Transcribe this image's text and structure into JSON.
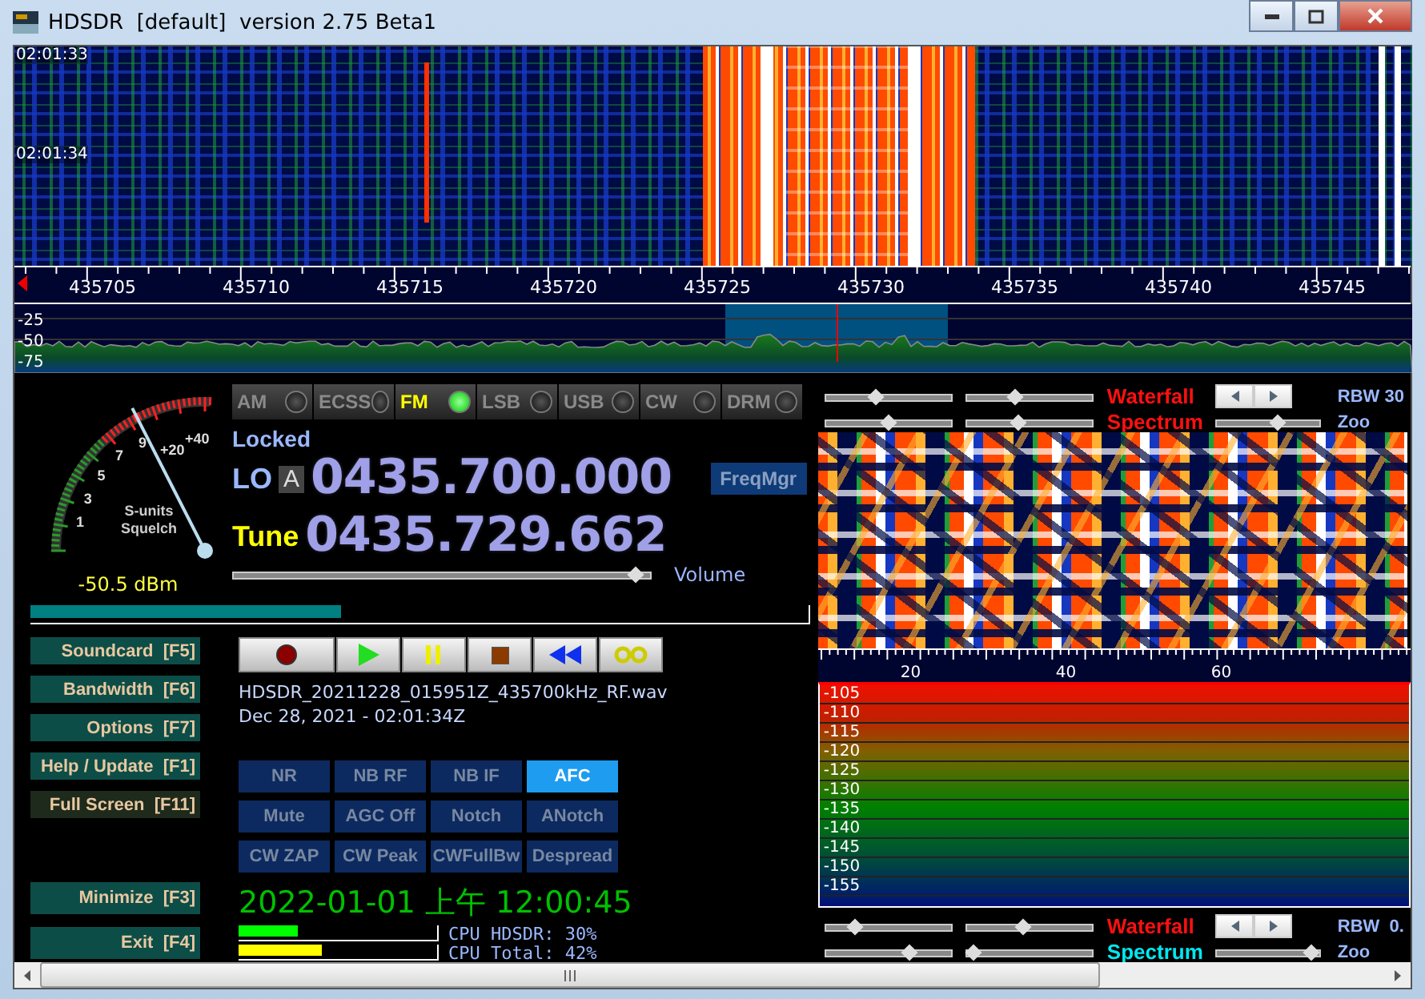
{
  "window": {
    "title": "HDSDR  [default]  version 2.75 Beta1"
  },
  "waterfall": {
    "timestamps": [
      "02:01:33",
      "02:01:34"
    ]
  },
  "frequency_scale": {
    "labels": [
      "435705",
      "435710",
      "435715",
      "435720",
      "435725",
      "435730",
      "435735",
      "435740",
      "435745"
    ]
  },
  "spectrum": {
    "db_labels": [
      "-25",
      "-50",
      "-75"
    ]
  },
  "s_meter": {
    "scale_labels": [
      "1",
      "3",
      "5",
      "7",
      "9",
      "+20",
      "+40"
    ],
    "unit_label": "S-units",
    "squelch_label": "Squelch",
    "reading": "-50.5 dBm",
    "level": 0.4
  },
  "modes": [
    {
      "label": "AM",
      "selected": false
    },
    {
      "label": "ECSS",
      "selected": false
    },
    {
      "label": "FM",
      "selected": true
    },
    {
      "label": "LSB",
      "selected": false
    },
    {
      "label": "USB",
      "selected": false
    },
    {
      "label": "CW",
      "selected": false
    },
    {
      "label": "DRM",
      "selected": false
    }
  ],
  "lo": {
    "status": "Locked",
    "label": "LO",
    "vfo": "A",
    "frequency": "0435.700.000"
  },
  "freq_manager_button": "FreqMgr",
  "tune": {
    "label": "Tune",
    "frequency": "0435.729.662"
  },
  "volume": {
    "label": "Volume",
    "level": 0.98
  },
  "side_buttons": [
    {
      "label": "Soundcard",
      "key": "[F5]",
      "dimmed": false
    },
    {
      "label": "Bandwidth",
      "key": "[F6]",
      "dimmed": false
    },
    {
      "label": "Options",
      "key": "[F7]",
      "dimmed": false
    },
    {
      "label": "Help / Update",
      "key": "[F1]",
      "dimmed": false
    },
    {
      "label": "Full Screen",
      "key": "[F11]",
      "dimmed": true
    },
    {
      "label": "Minimize",
      "key": "[F3]",
      "dimmed": false
    },
    {
      "label": "Exit",
      "key": "[F4]",
      "dimmed": false
    }
  ],
  "transport": [
    {
      "kind": "record"
    },
    {
      "kind": "play"
    },
    {
      "kind": "pause"
    },
    {
      "kind": "stop"
    },
    {
      "kind": "rewind"
    },
    {
      "kind": "loop"
    }
  ],
  "recording": {
    "file": "HDSDR_20211228_015951Z_435700kHz_RF.wav",
    "time": "Dec 28, 2021 - 02:01:34Z"
  },
  "dsp_buttons": [
    {
      "label": "NR",
      "on": false
    },
    {
      "label": "NB RF",
      "on": false
    },
    {
      "label": "NB IF",
      "on": false
    },
    {
      "label": "AFC",
      "on": true
    },
    {
      "label": "Mute",
      "on": false
    },
    {
      "label": "AGC Off",
      "on": false
    },
    {
      "label": "Notch",
      "on": false
    },
    {
      "label": "ANotch",
      "on": false
    },
    {
      "label": "CW ZAP",
      "on": false
    },
    {
      "label": "CW Peak",
      "on": false
    },
    {
      "label": "CWFullBw",
      "on": false
    },
    {
      "label": "Despread",
      "on": false
    }
  ],
  "clock": "2022-01-01 上午 12:00:45",
  "cpu": [
    {
      "label": "CPU HDSDR: 30%",
      "level": 0.3,
      "color": "#00ff00"
    },
    {
      "label": "CPU Total: 42%",
      "level": 0.42,
      "color": "#ffff00"
    }
  ],
  "zoom_panel": {
    "top_controls": {
      "waterfall_label": "Waterfall",
      "spectrum_label": "Spectrum",
      "spectrum_highlighted": false,
      "rbw": "RBW 30",
      "zoom": "Zoo",
      "sliders": [
        {
          "level": 0.38
        },
        {
          "level": 0.37
        },
        {
          "level": 0.5
        },
        {
          "level": 0.39
        },
        {
          "level": 0.6
        }
      ]
    },
    "scale_labels": [
      "20",
      "40",
      "60"
    ],
    "db_labels": [
      "-105",
      "-110",
      "-115",
      "-120",
      "-125",
      "-130",
      "-135",
      "-140",
      "-145",
      "-150",
      "-155"
    ],
    "bottom_controls": {
      "waterfall_label": "Waterfall",
      "spectrum_label": "Spectrum",
      "spectrum_highlighted": true,
      "rbw": "RBW  0.",
      "zoom": "Zoo",
      "sliders": [
        {
          "level": 0.2
        },
        {
          "level": 0.44
        },
        {
          "level": 0.68
        },
        {
          "level": 0.0
        },
        {
          "level": 0.98
        }
      ]
    }
  }
}
